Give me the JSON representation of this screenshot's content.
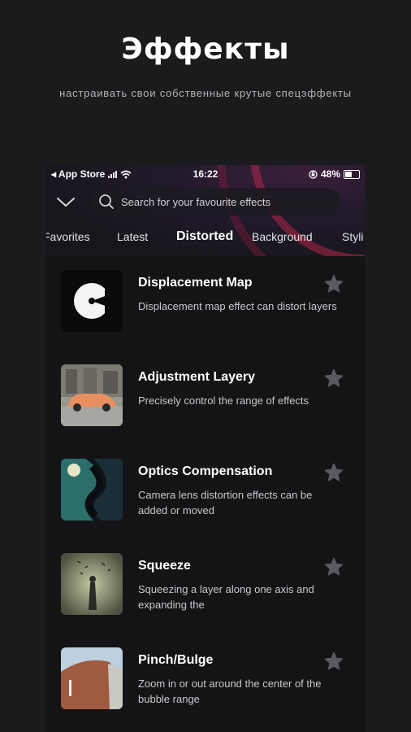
{
  "promo": {
    "title": "Эффекты",
    "subtitle": "настраивать свои собственные крутые спецэффекты"
  },
  "status_bar": {
    "carrier": "◂ App Store",
    "time": "16:22",
    "battery_text": "48%",
    "battery_level": 0.48
  },
  "search": {
    "placeholder": "Search for your favourite effects"
  },
  "tabs": [
    {
      "label": "Favorites",
      "active": false
    },
    {
      "label": "Latest",
      "active": false
    },
    {
      "label": "Distorted",
      "active": true
    },
    {
      "label": "Background",
      "active": false
    },
    {
      "label": "Styli",
      "active": false
    }
  ],
  "effects": [
    {
      "title": "Displacement Map",
      "description": "Displacement map effect can distort layers"
    },
    {
      "title": "Adjustment Layery",
      "description": "Precisely control the range of effects"
    },
    {
      "title": "Optics Compensation",
      "description": "Camera lens distortion effects can be added or moved"
    },
    {
      "title": "Squeeze",
      "description": "Squeezing a layer along one axis and expanding the"
    },
    {
      "title": "Pinch/Bulge",
      "description": "Zoom in or out around the center of the bubble range"
    }
  ],
  "colors": {
    "background": "#1b1b1d",
    "phone_bg": "#141416",
    "star": "#5a5a5e",
    "accent_arc": "#d22850"
  }
}
